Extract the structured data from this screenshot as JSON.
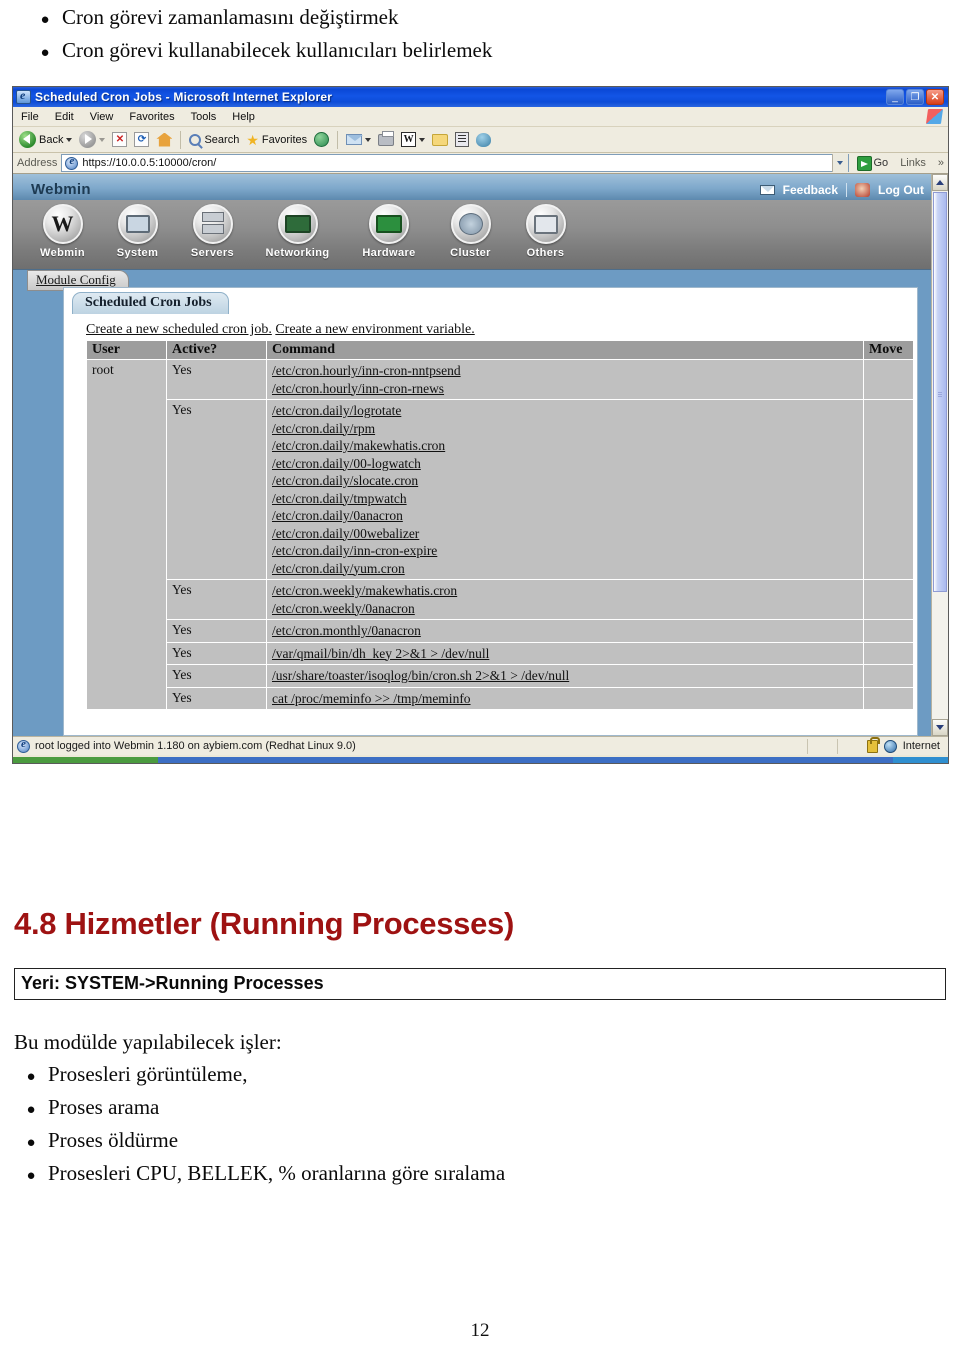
{
  "doc": {
    "top_bullets": [
      "Cron görevi zamanlamasını değiştirmek",
      "Cron görevi kullanabilecek kullanıcıları belirlemek"
    ],
    "section_heading": "4.8 Hizmetler (Running Processes)",
    "location_line": "Yeri: SYSTEM->Running Processes",
    "intro_line": "Bu modülde yapılabilecek işler:",
    "bottom_bullets": [
      "Prosesleri görüntüleme,",
      "Proses arama",
      "Proses öldürme",
      "Prosesleri CPU, BELLEK, % oranlarına göre sıralama"
    ],
    "page_number": "12"
  },
  "browser": {
    "title": "Scheduled Cron Jobs - Microsoft Internet Explorer",
    "window_buttons": {
      "minimize": "_",
      "maximize": "❐",
      "close": "✕"
    },
    "menus": [
      "File",
      "Edit",
      "View",
      "Favorites",
      "Tools",
      "Help"
    ],
    "toolbar": {
      "back": "Back",
      "search": "Search",
      "favorites": "Favorites"
    },
    "address": {
      "label": "Address",
      "value": "https://10.0.0.5:10000/cron/",
      "go": "Go",
      "links": "Links"
    },
    "status": {
      "text": "root logged into Webmin 1.180 on aybiem.com (Redhat Linux 9.0)",
      "zone": "Internet"
    }
  },
  "webmin": {
    "brand": "Webmin",
    "feedback": "Feedback",
    "logout": "Log Out",
    "nav": [
      {
        "label": "Webmin",
        "icon": "webmin-icon"
      },
      {
        "label": "System",
        "icon": "system-icon"
      },
      {
        "label": "Servers",
        "icon": "servers-icon"
      },
      {
        "label": "Networking",
        "icon": "networking-icon"
      },
      {
        "label": "Hardware",
        "icon": "hardware-icon"
      },
      {
        "label": "Cluster",
        "icon": "cluster-icon"
      },
      {
        "label": "Others",
        "icon": "others-icon"
      }
    ],
    "module_config": "Module Config",
    "page_tab": "Scheduled Cron Jobs",
    "links": {
      "create_job": "Create a new scheduled cron job.",
      "create_env": "Create a new environment variable."
    },
    "table": {
      "headers": [
        "User",
        "Active?",
        "Command",
        "Move"
      ],
      "rows": [
        {
          "user": "root",
          "active": "Yes",
          "commands": [
            "/etc/cron.hourly/inn-cron-nntpsend",
            "/etc/cron.hourly/inn-cron-rnews"
          ]
        },
        {
          "user": "",
          "active": "Yes",
          "commands": [
            "/etc/cron.daily/logrotate",
            "/etc/cron.daily/rpm",
            "/etc/cron.daily/makewhatis.cron",
            "/etc/cron.daily/00-logwatch",
            "/etc/cron.daily/slocate.cron",
            "/etc/cron.daily/tmpwatch",
            "/etc/cron.daily/0anacron",
            "/etc/cron.daily/00webalizer",
            "/etc/cron.daily/inn-cron-expire",
            "/etc/cron.daily/yum.cron"
          ]
        },
        {
          "user": "",
          "active": "Yes",
          "commands": [
            "/etc/cron.weekly/makewhatis.cron",
            "/etc/cron.weekly/0anacron"
          ]
        },
        {
          "user": "",
          "active": "Yes",
          "commands": [
            "/etc/cron.monthly/0anacron"
          ]
        },
        {
          "user": "",
          "active": "Yes",
          "commands": [
            "/var/qmail/bin/dh_key 2>&1 > /dev/null"
          ]
        },
        {
          "user": "",
          "active": "Yes",
          "commands": [
            "/usr/share/toaster/isoqlog/bin/cron.sh 2>&1 > /dev/null"
          ]
        },
        {
          "user": "",
          "active": "Yes",
          "commands": [
            "cat /proc/meminfo >> /tmp/meminfo"
          ]
        }
      ]
    }
  },
  "colors": {
    "heading_red": "#9e1212",
    "webmin_blue": "#6d9bc3",
    "title_blue": "#0d4cd8",
    "table_header_grey": "#9d9d9d",
    "table_cell_grey": "#c0c0c0"
  }
}
